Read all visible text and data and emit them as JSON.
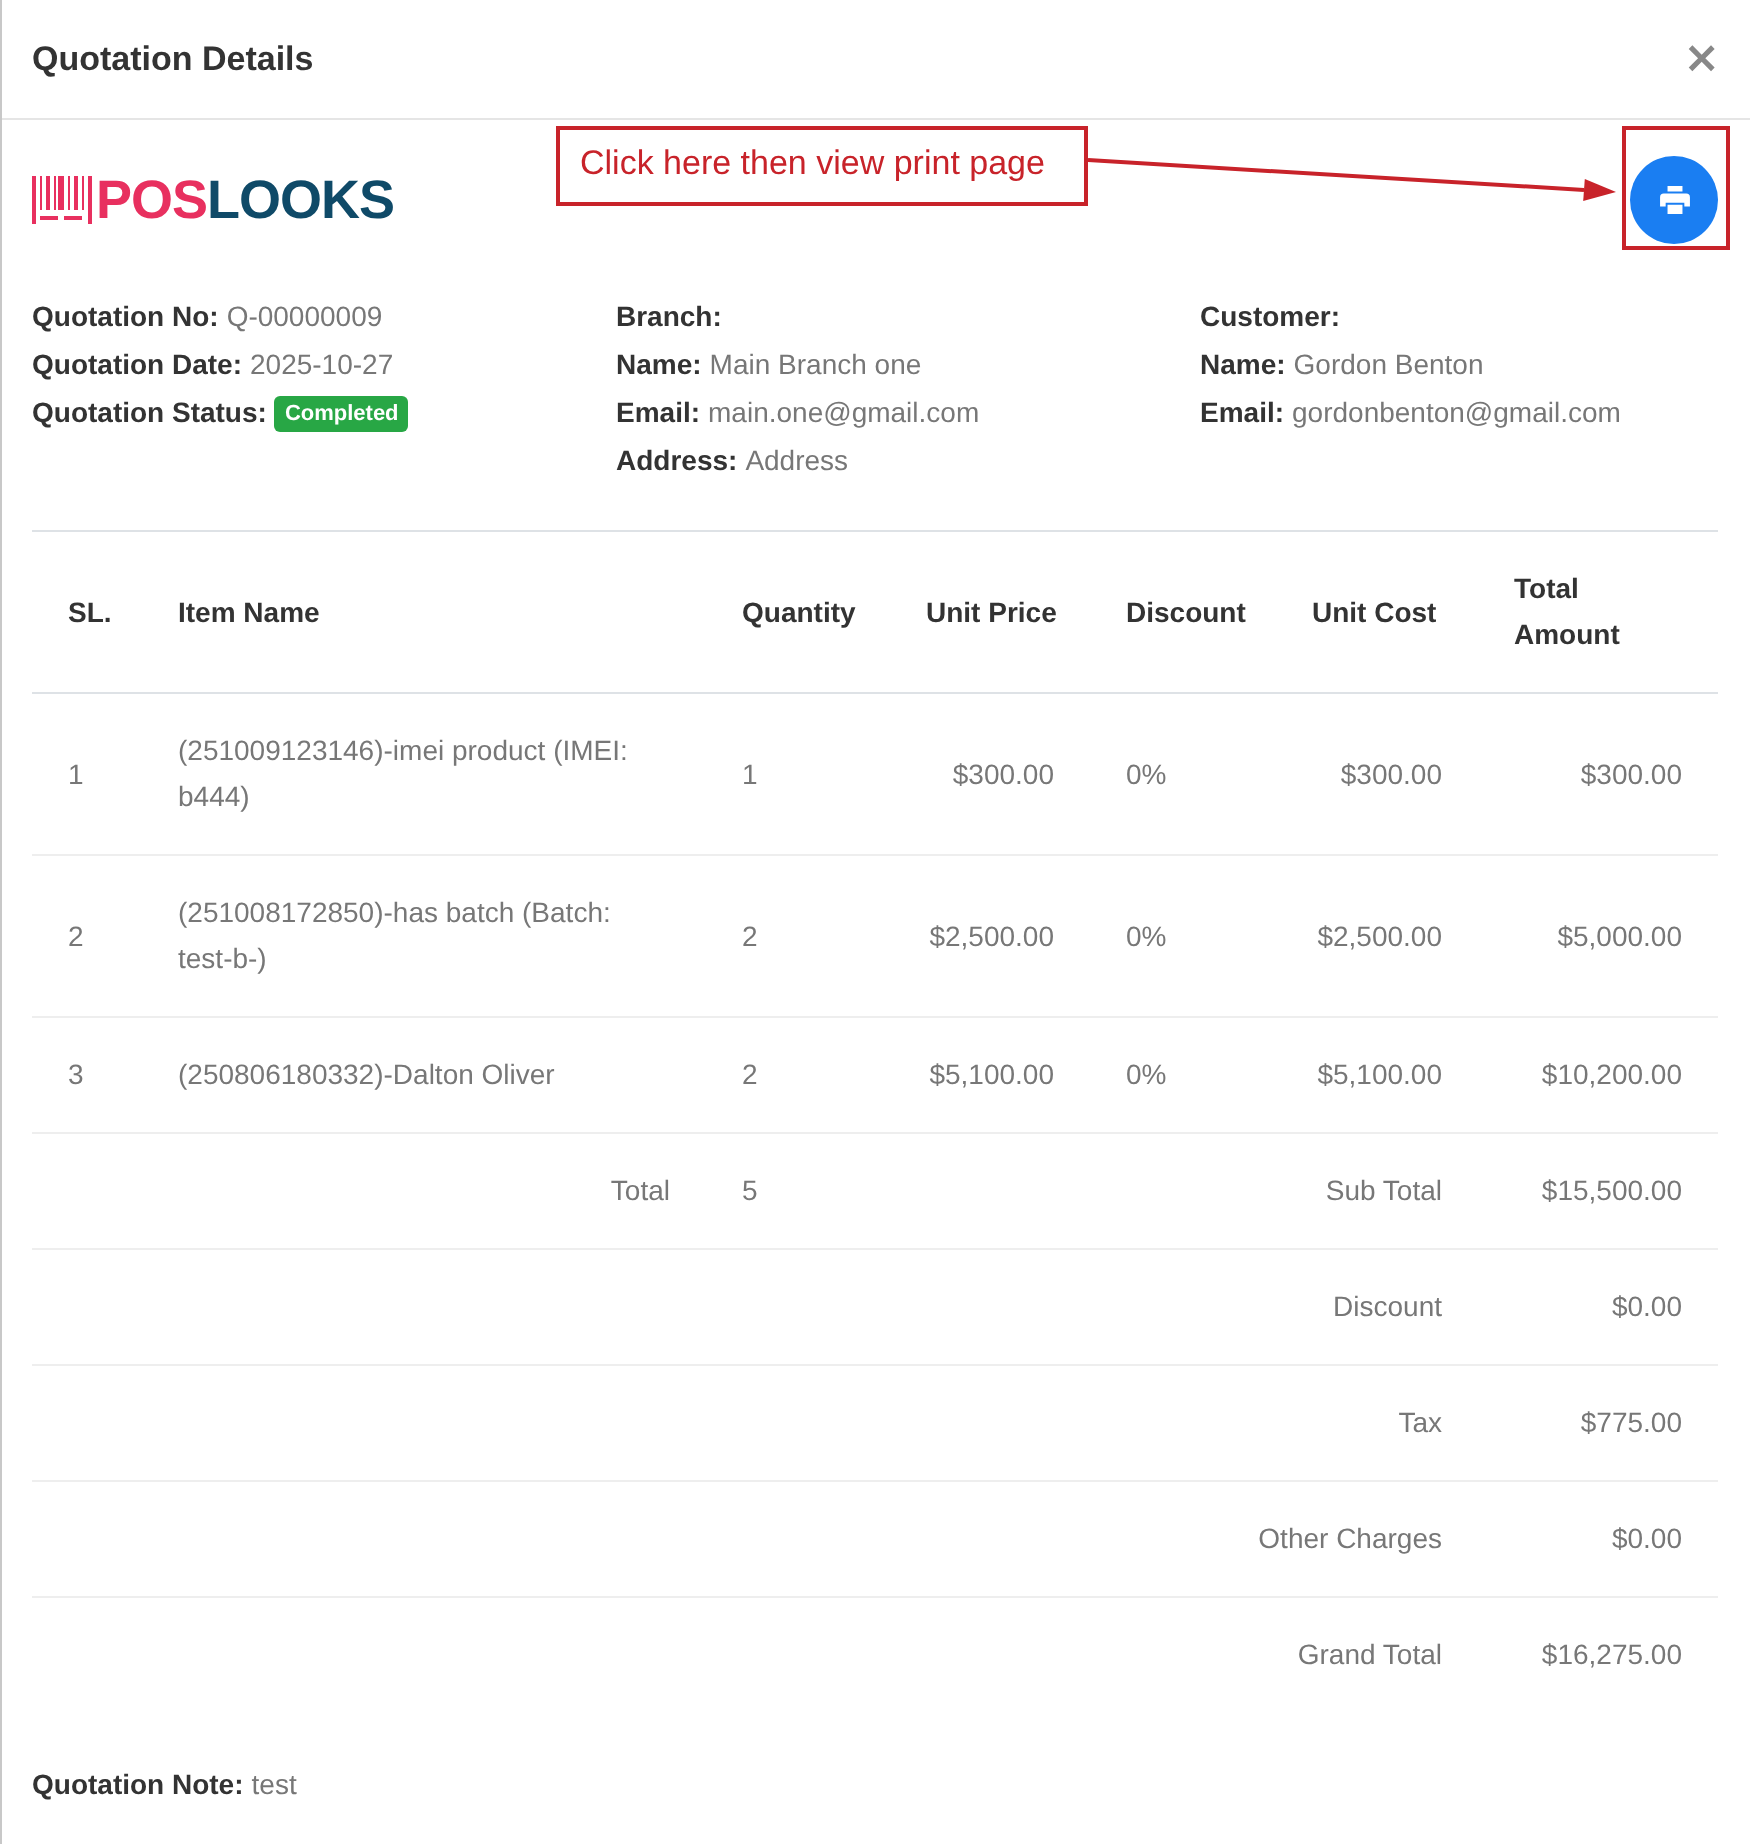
{
  "modal": {
    "title": "Quotation Details",
    "close": "×"
  },
  "logo": {
    "parts": [
      {
        "text": "POS",
        "color": "#e8305f"
      },
      {
        "text": "LOOKS",
        "color": "#0f4a68"
      }
    ]
  },
  "annotation": {
    "text": "Click here then view print page"
  },
  "details": [
    {
      "fields": [
        {
          "kind": "text",
          "label": "Quotation No:",
          "value": "Q-00000009"
        },
        {
          "kind": "text",
          "label": "Quotation Date:",
          "value": "2025-10-27"
        },
        {
          "kind": "badge",
          "label": "Quotation Status:",
          "value": "Completed"
        }
      ]
    },
    {
      "heading": "Branch:",
      "fields": [
        {
          "kind": "text",
          "label": "Name:",
          "value": "Main Branch one"
        },
        {
          "kind": "text",
          "label": "Email:",
          "value": "main.one@gmail.com"
        },
        {
          "kind": "text",
          "label": "Address:",
          "value": "Address"
        }
      ]
    },
    {
      "heading": "Customer:",
      "fields": [
        {
          "kind": "text",
          "label": "Name:",
          "value": "Gordon Benton"
        },
        {
          "kind": "text",
          "label": "Email:",
          "value": "gordonbenton@gmail.com"
        }
      ]
    }
  ],
  "table": {
    "columns": [
      "SL.",
      "Item Name",
      "Quantity",
      "Unit Price",
      "Discount",
      "Unit Cost",
      "Total Amount"
    ],
    "rows": [
      {
        "cells": [
          "1",
          "(251009123146)-imei product (IMEI: b444)",
          "1",
          "$300.00",
          "0%",
          "$300.00",
          "$300.00"
        ]
      },
      {
        "cells": [
          "2",
          "(251008172850)-has batch (Batch: test-b-)",
          "2",
          "$2,500.00",
          "0%",
          "$2,500.00",
          "$5,000.00"
        ]
      },
      {
        "cells": [
          "3",
          "(250806180332)-Dalton Oliver",
          "2",
          "$5,100.00",
          "0%",
          "$5,100.00",
          "$10,200.00"
        ]
      }
    ],
    "total": {
      "label": "Total",
      "quantity": "5"
    },
    "summary": [
      {
        "label": "Sub Total",
        "value": "$15,500.00"
      },
      {
        "label": "Discount",
        "value": "$0.00"
      },
      {
        "label": "Tax",
        "value": "$775.00"
      },
      {
        "label": "Other Charges",
        "value": "$0.00"
      },
      {
        "label": "Grand Total",
        "value": "$16,275.00"
      }
    ]
  },
  "note": {
    "label": "Quotation Note:",
    "value": "test"
  }
}
